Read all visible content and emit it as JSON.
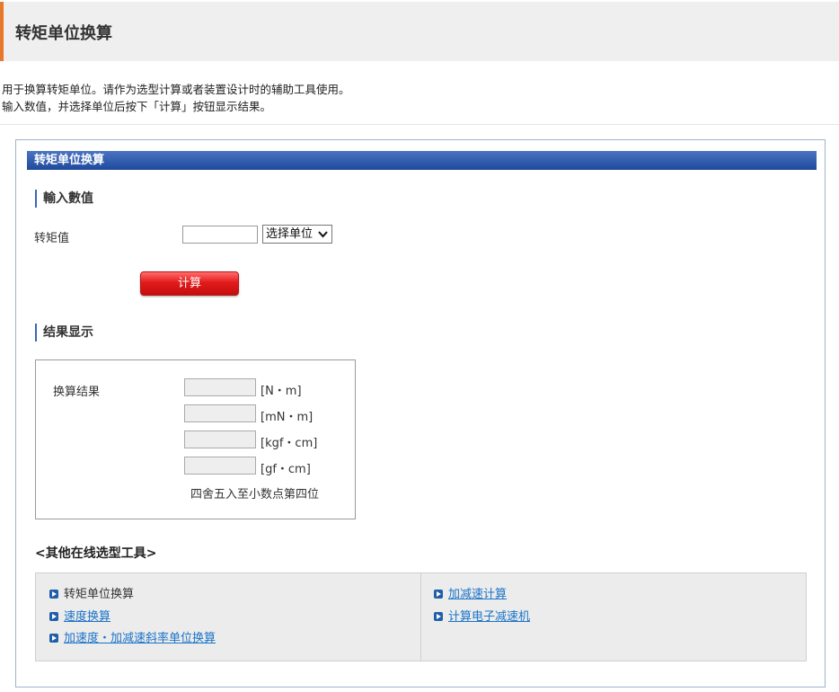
{
  "page": {
    "title": "转矩单位换算",
    "intro_line1": "用于换算转矩单位。请作为选型计算或者装置设计时的辅助工具使用。",
    "intro_line2": "输入数值，并选择单位后按下「计算」按钮显示结果。"
  },
  "tool": {
    "bar_title": "转矩单位换算",
    "input_section": "輸入數值",
    "torque_label": "转矩值",
    "torque_value": "",
    "unit_select": "选择单位",
    "calc_button": "计算"
  },
  "results": {
    "section": "结果显示",
    "label": "换算结果",
    "rows": [
      {
        "unit": "[N・m]",
        "value": ""
      },
      {
        "unit": "[mN・m]",
        "value": ""
      },
      {
        "unit": "[kgf・cm]",
        "value": ""
      },
      {
        "unit": "[gf・cm]",
        "value": ""
      }
    ],
    "note": "四舍五入至小数点第四位"
  },
  "other_tools": {
    "title": "<其他在线选型工具>",
    "left": [
      {
        "label": "转矩单位换算",
        "is_link": false
      },
      {
        "label": "速度换算",
        "is_link": true
      },
      {
        "label": "加速度・加减速斜率单位换算",
        "is_link": true
      }
    ],
    "right": [
      {
        "label": "加减速计算",
        "is_link": true
      },
      {
        "label": "计算电子减速机",
        "is_link": true
      }
    ]
  },
  "colors": {
    "accent_orange": "#e8792b",
    "bar_blue": "#2a56a8",
    "button_red": "#e21b1b",
    "link_blue": "#1a73c8"
  }
}
